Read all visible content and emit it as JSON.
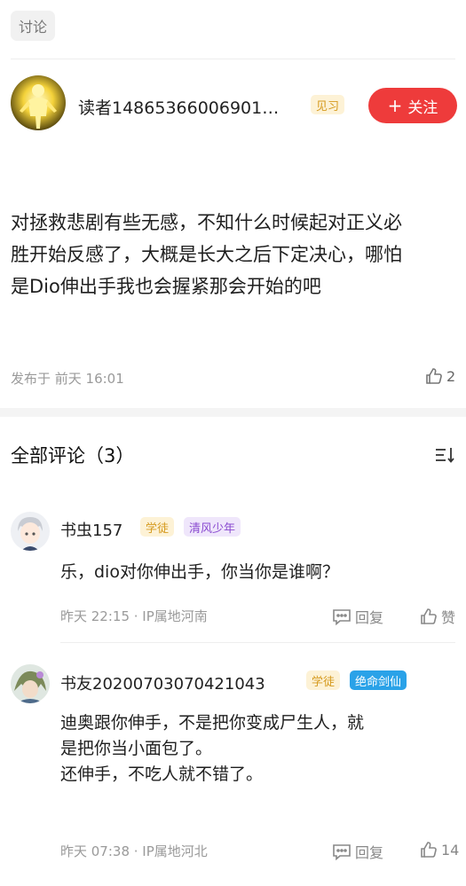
{
  "header": {
    "tag_label": "讨论"
  },
  "post": {
    "author_name": "读者14865366006901…",
    "author_badge": "见习",
    "follow_label": "关注",
    "follow_icon": "plus-icon",
    "content_lines": [
      "对拯救悲剧有些无感，不知什么时候起对正义必",
      "胜开始反感了，大概是长大之后下定决心，哪怕",
      "是Dio伸出手我也会握紧那会开始的吧"
    ],
    "published": "发布于 前天 16:01",
    "like_count": "2",
    "like_icon": "thumbs-up-icon"
  },
  "comments_section": {
    "title": "全部评论（3）",
    "sort_icon": "sort-list-icon",
    "comments": [
      {
        "name": "书虫157",
        "badges": [
          "学徒",
          "清风少年"
        ],
        "lines": [
          "乐，dio对你伸出手，你当你是谁啊？"
        ],
        "time": "昨天 22:15 · IP属地河南",
        "reply_label": "回复",
        "like_label": "赞"
      },
      {
        "name": "书友20200703070421043",
        "badges": [
          "学徒",
          "绝命剑仙"
        ],
        "lines": [
          "迪奥跟你伸手，不是把你变成尸生人，就",
          "是把你当小面包了。",
          "还伸手，不吃人就不错了。"
        ],
        "time": "昨天 07:38 · IP属地河北",
        "reply_label": "回复",
        "like_label": "14"
      }
    ]
  },
  "colors": {
    "accent": "#ee3b3b",
    "badge_yellow": "#d59a1e",
    "badge_purple": "#8a4bd0",
    "badge_blue": "#2aa2e8"
  }
}
